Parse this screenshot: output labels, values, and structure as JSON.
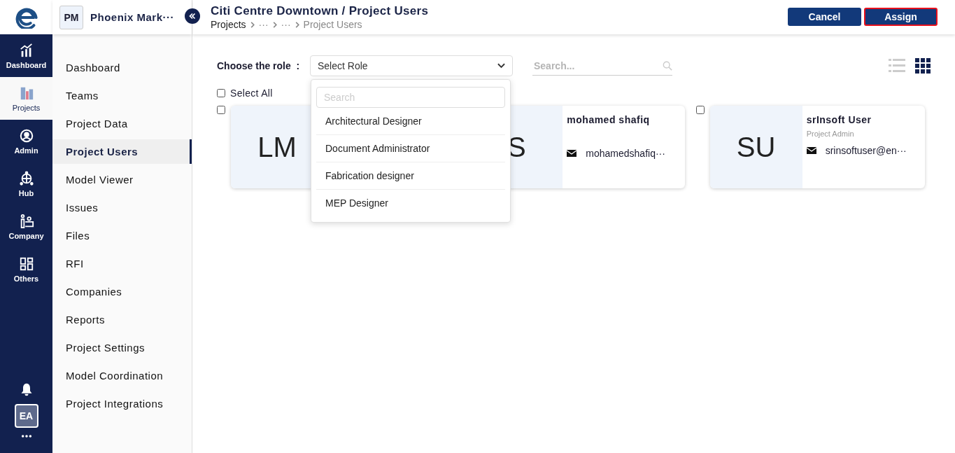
{
  "rail": {
    "items": [
      {
        "label": "Dashboard",
        "selected": false
      },
      {
        "label": "Projects",
        "selected": true
      },
      {
        "label": "Admin",
        "selected": false
      },
      {
        "label": "Hub",
        "selected": false
      },
      {
        "label": "Company",
        "selected": false
      },
      {
        "label": "Others",
        "selected": false
      }
    ],
    "avatar": "EA"
  },
  "project": {
    "badge": "PM",
    "name": "Phoenix Mark···"
  },
  "menu": [
    {
      "label": "Dashboard",
      "selected": false
    },
    {
      "label": "Teams",
      "selected": false
    },
    {
      "label": "Project Data",
      "selected": false
    },
    {
      "label": "Project Users",
      "selected": true
    },
    {
      "label": "Model Viewer",
      "selected": false
    },
    {
      "label": "Issues",
      "selected": false
    },
    {
      "label": "Files",
      "selected": false
    },
    {
      "label": "RFI",
      "selected": false
    },
    {
      "label": "Companies",
      "selected": false
    },
    {
      "label": "Reports",
      "selected": false
    },
    {
      "label": "Project Settings",
      "selected": false
    },
    {
      "label": "Model Coordination",
      "selected": false
    },
    {
      "label": "Project Integrations",
      "selected": false
    }
  ],
  "header": {
    "title": "Citi Centre Downtown / Project Users",
    "breadcrumb": [
      "Projects",
      "···",
      "···",
      "Project Users"
    ],
    "buttons": [
      {
        "label": "Cancel",
        "highlighted": false
      },
      {
        "label": "Assign",
        "highlighted": true
      }
    ]
  },
  "toolbar": {
    "role_label": "Choose the role  :",
    "role_select": "Select Role",
    "search": {
      "placeholder": "Search..."
    },
    "views": [
      {
        "selected": false
      },
      {
        "selected": true
      }
    ]
  },
  "select_all": {
    "label": "Select All",
    "checked": false
  },
  "dropdown": {
    "search": {
      "placeholder": "Search"
    },
    "options": [
      "Architectural Designer",
      "Document Administrator",
      "Fabrication designer",
      "MEP Designer"
    ]
  },
  "users": [
    {
      "initials": "LM",
      "checked": false
    },
    {
      "initials": "S",
      "name": "mohamed shafiq",
      "email": "mohamedshafiq···"
    },
    {
      "initials": "SU",
      "name": "srInsoft User",
      "role": "Project Admin",
      "email": "srinsoftuser@en···",
      "checked": false
    }
  ]
}
